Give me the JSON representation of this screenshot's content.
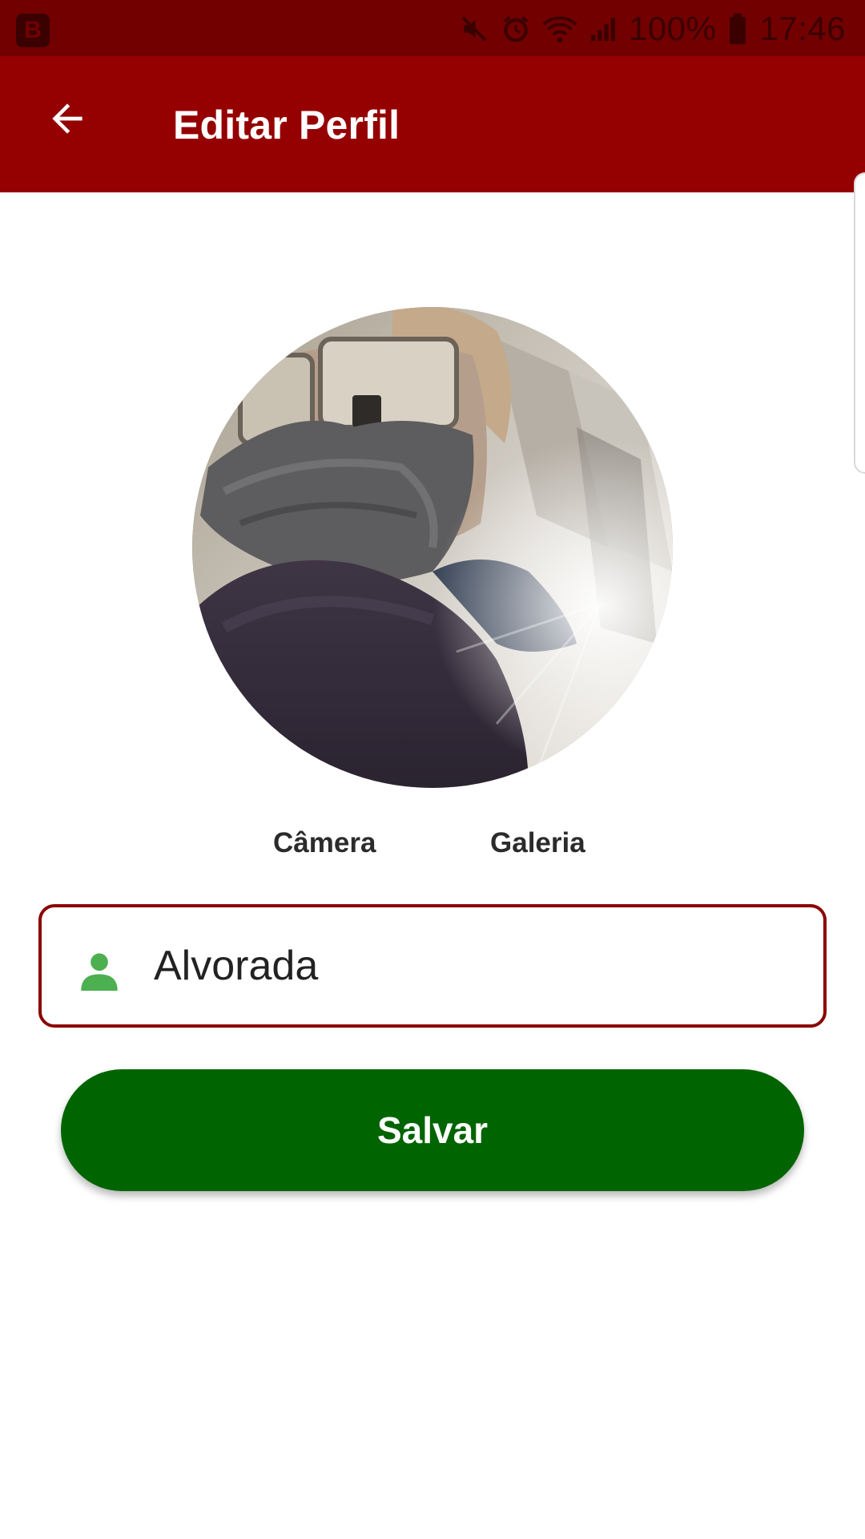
{
  "status_bar": {
    "app_badge": "B",
    "battery_percent": "100%",
    "time": "17:46",
    "icons": [
      "mute-icon",
      "alarm-icon",
      "wifi-icon",
      "signal-icon",
      "battery-icon"
    ]
  },
  "app_bar": {
    "title": "Editar Perfil",
    "back_icon": "arrow-left-icon"
  },
  "profile": {
    "camera_label": "Câmera",
    "gallery_label": "Galeria",
    "name_value": "Alvorada",
    "name_icon": "person-icon"
  },
  "actions": {
    "save_label": "Salvar"
  },
  "colors": {
    "status_bar": "#720000",
    "app_bar": "#950000",
    "field_border": "#8b0000",
    "save_button": "#006400",
    "person_icon": "#4caf50"
  }
}
